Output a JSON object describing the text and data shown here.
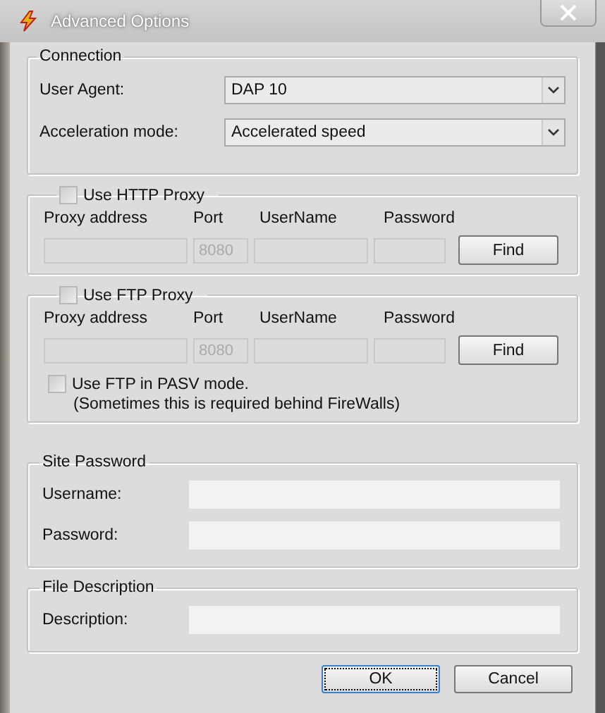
{
  "window": {
    "title": "Advanced Options"
  },
  "connection": {
    "title": "Connection",
    "fields": [
      {
        "label": "User Agent:",
        "value": "DAP 10"
      },
      {
        "label": "Acceleration mode:",
        "value": "Accelerated speed"
      }
    ]
  },
  "proxies": [
    {
      "label": "Use HTTP Proxy",
      "checked": false,
      "columns": [
        "Proxy address",
        "Port",
        "UserName",
        "Password"
      ],
      "port": "8080",
      "disabled": true,
      "button": "Find"
    },
    {
      "label": "Use FTP Proxy",
      "checked": false,
      "columns": [
        "Proxy address",
        "Port",
        "UserName",
        "Password"
      ],
      "port": "8080",
      "disabled": true,
      "button": "Find",
      "option": {
        "label": "Use FTP in PASV mode.",
        "note": "(Sometimes this is required behind FireWalls)",
        "checked": false
      }
    }
  ],
  "site_password": {
    "title": "Site Password",
    "fields": [
      {
        "label": "Username:"
      },
      {
        "label": "Password:"
      }
    ]
  },
  "file_description": {
    "title": "File Description",
    "fields": [
      {
        "label": "Description:"
      }
    ]
  },
  "buttons": [
    {
      "label": "OK",
      "default": true
    },
    {
      "label": "Cancel",
      "default": false
    }
  ]
}
